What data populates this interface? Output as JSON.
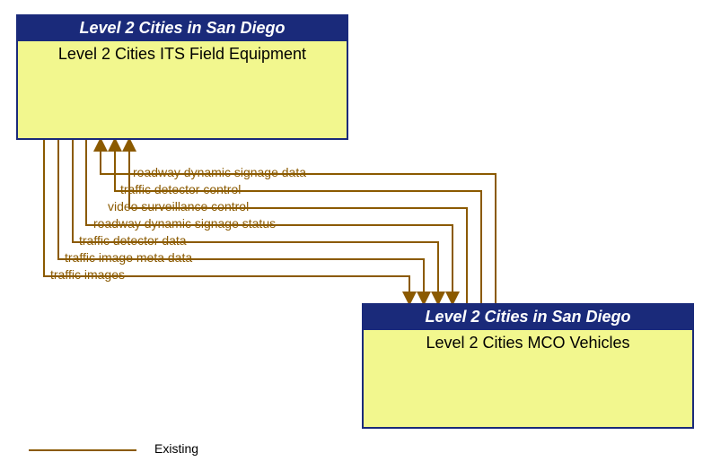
{
  "entities": {
    "topLeft": {
      "header": "Level 2 Cities in San Diego",
      "title": "Level 2 Cities ITS Field Equipment"
    },
    "bottomRight": {
      "header": "Level 2 Cities in San Diego",
      "title": "Level 2 Cities MCO Vehicles"
    }
  },
  "flows": [
    {
      "label": "roadway dynamic signage data",
      "dir": "to_top"
    },
    {
      "label": "traffic detector control",
      "dir": "to_top"
    },
    {
      "label": "video surveillance control",
      "dir": "to_top"
    },
    {
      "label": "roadway dynamic signage status",
      "dir": "to_bottom"
    },
    {
      "label": "traffic detector data",
      "dir": "to_bottom"
    },
    {
      "label": "traffic image meta data",
      "dir": "to_bottom"
    },
    {
      "label": "traffic images",
      "dir": "to_bottom"
    }
  ],
  "legend": {
    "existing": "Existing"
  },
  "colors": {
    "flow": "#8b5a00",
    "header": "#1a2a7a",
    "body": "#f2f78e"
  }
}
